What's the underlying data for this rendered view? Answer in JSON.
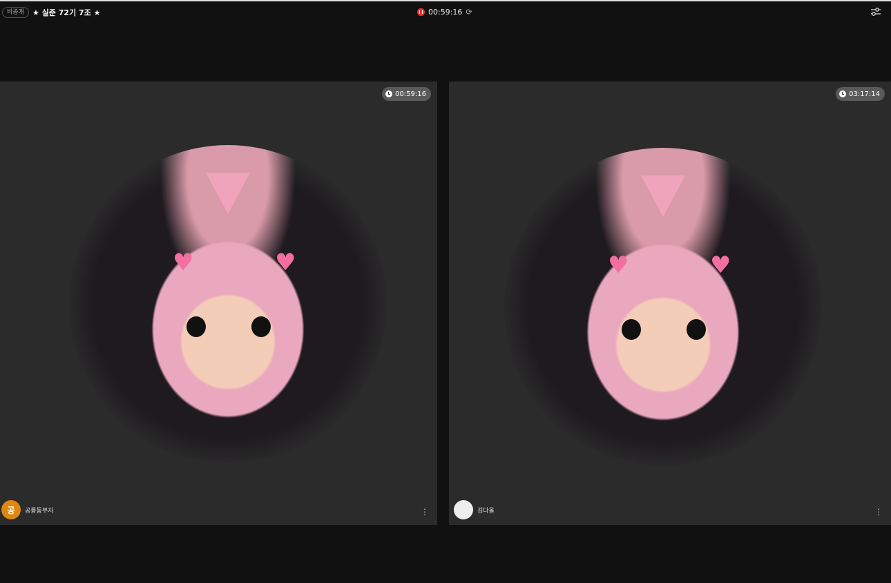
{
  "topbar": {
    "visibility_badge": "비공개",
    "title": "★ 실준 72기 7조 ★",
    "recording_time": "00:59:16"
  },
  "tiles": [
    {
      "timer": "00:59:16",
      "user_name": "공룡동부자",
      "avatar_initial": "공"
    },
    {
      "timer": "03:17:14",
      "user_name": "김다올",
      "avatar_initial": ""
    }
  ],
  "colors": {
    "accent_record": "#ee3333",
    "avatar_orange": "#e0870f"
  }
}
